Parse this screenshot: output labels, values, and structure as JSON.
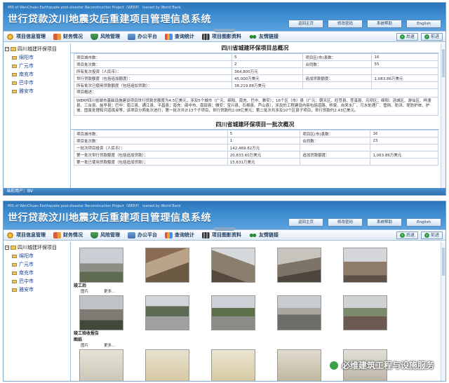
{
  "header": {
    "subtitle": "MIS of WenChuan Earthquake post-disaster Reconstruction Project（WERP） loaned by World Bank",
    "title": "世行贷款汶川地震灾后重建项目管理信息系统",
    "buttons": [
      "返回主页",
      "修改密码",
      "系统帮助",
      "English"
    ]
  },
  "nav": {
    "items": [
      {
        "label": "项目信息管理",
        "icon": "gear-icon"
      },
      {
        "label": "财务情况",
        "icon": "book-icon"
      },
      {
        "label": "风险管理",
        "icon": "shield-icon"
      },
      {
        "label": "办公平台",
        "icon": "office-icon"
      },
      {
        "label": "查询统计",
        "icon": "chart-icon"
      },
      {
        "label": "项目图影资料",
        "icon": "film-icon"
      },
      {
        "label": "友情链接",
        "icon": "link-icon"
      }
    ],
    "back_label": "后退",
    "forward_label": "前进"
  },
  "sidebar": {
    "root": "四川城建环保项目",
    "items": [
      "绵阳市",
      "广元市",
      "南充市",
      "巴中市",
      "雅安市"
    ]
  },
  "overview": {
    "title": "四川省城建环保项目总概况",
    "rows": [
      [
        "项目城市数：",
        "5",
        "项目区(市)县数：",
        "16"
      ],
      [
        "项目批次数：",
        "2",
        "合同数：",
        "55"
      ],
      [
        "所有批次投资（人民币）：",
        "364,800万元",
        "",
        ""
      ],
      [
        "世行贷款额度（包括追加额度）：",
        "45,000万美元",
        "追加贷款额度：",
        "1,083.86万美元"
      ],
      [
        "所有批次已使用贷款额度（包括追加贷款）：",
        "38,219.88万美元",
        "",
        ""
      ]
    ],
    "summary_label": "项目概述：",
    "summary_text": "WERP四川省城市基础设施建设项目世行贷款总额度为4.5亿美元，涉及5个城市（广元、绵阳、南充、巴中、雅安）；16个区（市）县（广元：朝天区、旺苍县、苍溪县、元坝区；绵阳：涪城区、游仙区、梓潼县、三台县、盐亭县；巴中：南江县、通江县、平昌县；南充：阆中市、南部县；雅安：宝兴县、石棉县、芦山县），涉及的工程建设内容包括道路、桥梁、自来水厂、污水处理厂、管网、防洪、堤防护岸、护坡、固废处理和河道疏浚等，该项目分两批次进行，第一批次共计13个子项目，世行贷款约2.08亿美元；第二批次共涉及10个区县子项目，世行贷款约2.43亿美元。"
  },
  "batch1": {
    "title": "四川省城建环保项目一批次概况",
    "rows": [
      [
        "项目城市数：",
        "5",
        "项目区(市)县数：",
        "16"
      ],
      [
        "项目批次数：",
        "1",
        "合同数：",
        "23"
      ],
      [
        "一批次项目投资（人民币）：",
        "142,469.82万元",
        "",
        ""
      ],
      [
        "第一批次世行贷款额度（包括追加贷款）：",
        "20,833.60万美元",
        "追加贷款额度：",
        "1,063.86万美元"
      ],
      [
        "第一批已使用贷款额度（包括追加贷款）：",
        "15,631万美元",
        "",
        ""
      ]
    ]
  },
  "status": {
    "user": "当前用户：BV"
  },
  "gallery": {
    "label_after": "竣工后",
    "label_report": "竣工验收报告",
    "label_drawings": "图纸",
    "meta": [
      {
        "name": "图片",
        "more": "更多..."
      }
    ]
  },
  "watermark": {
    "text": "必维建筑工程与设施服务"
  }
}
